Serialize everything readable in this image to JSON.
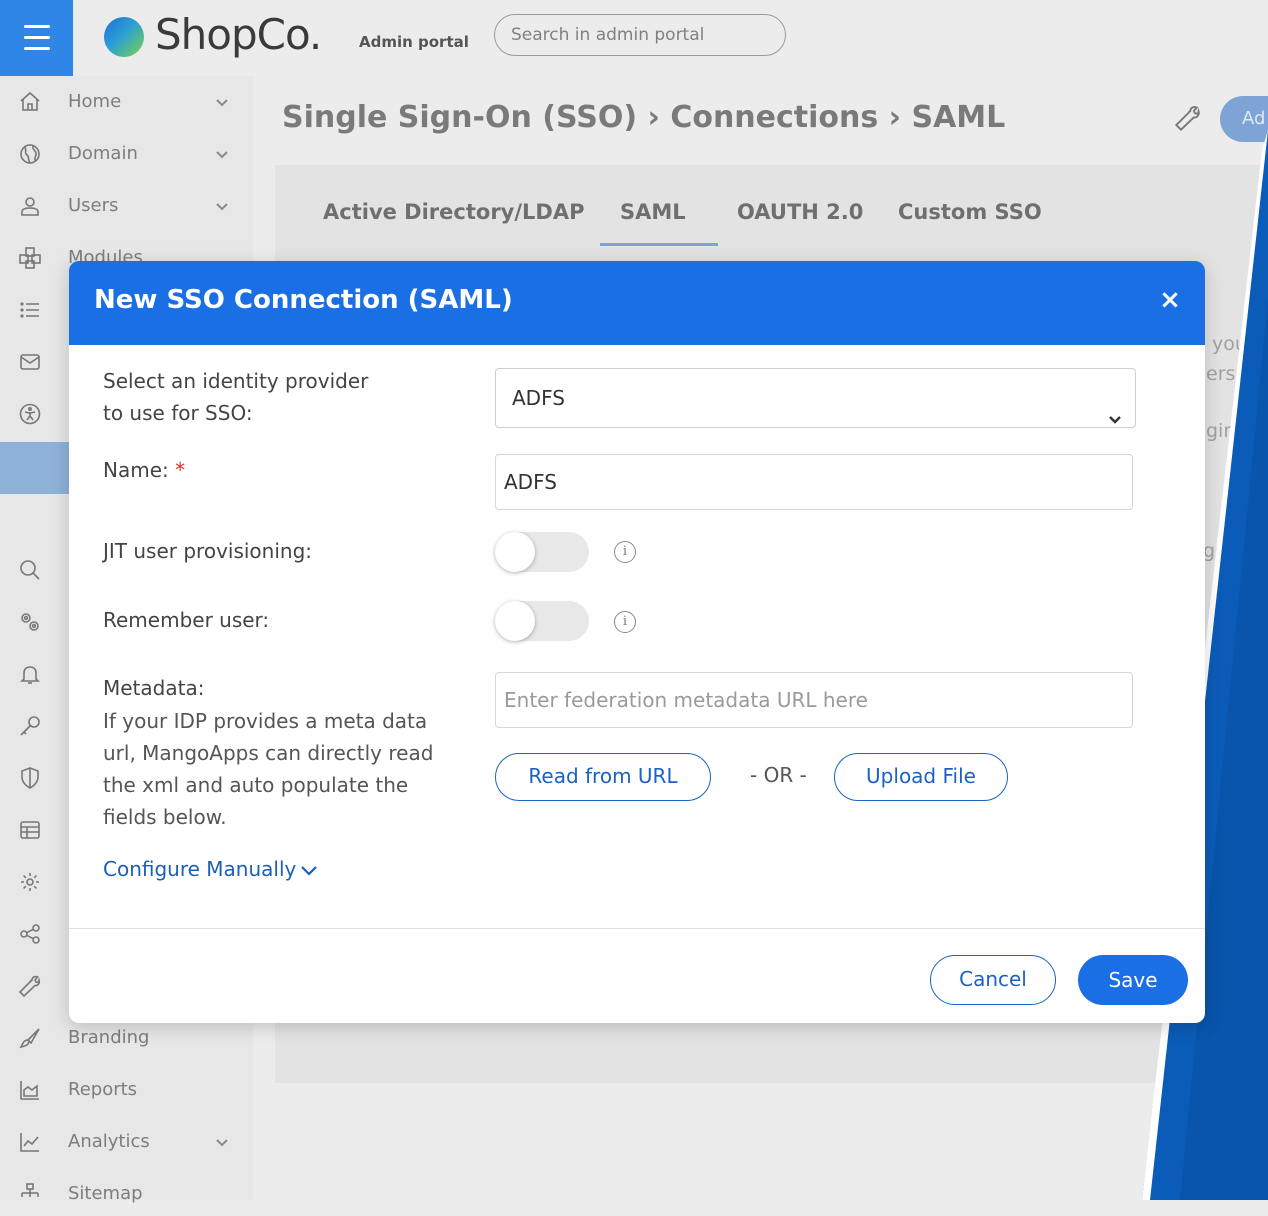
{
  "topbar": {
    "logo_text": "ShopCo.",
    "portal_label": "Admin portal",
    "search_placeholder": "Search in admin portal"
  },
  "sidebar": {
    "items": [
      {
        "label": "Home",
        "icon": "home-icon",
        "chevron": true
      },
      {
        "label": "Domain",
        "icon": "globe-icon",
        "chevron": true
      },
      {
        "label": "Users",
        "icon": "user-icon",
        "chevron": true
      },
      {
        "label": "Modules",
        "icon": "modules-icon",
        "chevron": false
      },
      {
        "label": "Branding",
        "icon": "brush-icon",
        "chevron": false
      },
      {
        "label": "Reports",
        "icon": "reports-icon",
        "chevron": false
      },
      {
        "label": "Analytics",
        "icon": "analytics-icon",
        "chevron": true
      },
      {
        "label": "Sitemap",
        "icon": "sitemap-icon",
        "chevron": false
      }
    ]
  },
  "main": {
    "breadcrumb": "Single Sign-On (SSO) › Connections › SAML",
    "add_button": "Ad",
    "tabs": [
      {
        "label": "Active Directory/LDAP",
        "active": false
      },
      {
        "label": "SAML",
        "active": true
      },
      {
        "label": "OAUTH 2.0",
        "active": false
      },
      {
        "label": "Custom SSO",
        "active": false
      }
    ],
    "peek": [
      "you",
      "ers",
      "gin",
      "gs"
    ]
  },
  "modal": {
    "title": "New SSO Connection (SAML)",
    "close": "×",
    "idp_label_line1": "Select an identity provider",
    "idp_label_line2": "to use for SSO:",
    "idp_value": "ADFS",
    "name_label": "Name:",
    "name_required": "*",
    "name_value": "ADFS",
    "jit_label": "JIT user provisioning:",
    "remember_label": "Remember user:",
    "metadata_label": "Metadata:",
    "metadata_help": [
      "If your IDP provides a meta data",
      "url, MangoApps can directly read",
      "the xml and auto populate the",
      "fields below."
    ],
    "metadata_placeholder": "Enter federation metadata URL here",
    "read_button": "Read from URL",
    "or_text": "- OR -",
    "upload_button": "Upload File",
    "configure_link": "Configure Manually",
    "cancel": "Cancel",
    "save": "Save",
    "info_glyph": "i"
  },
  "colors": {
    "brand_blue": "#1b6fe4",
    "link_blue": "#1b62c4",
    "required_red": "#d9302c",
    "diagonal_blue": "#0b5cb8"
  }
}
